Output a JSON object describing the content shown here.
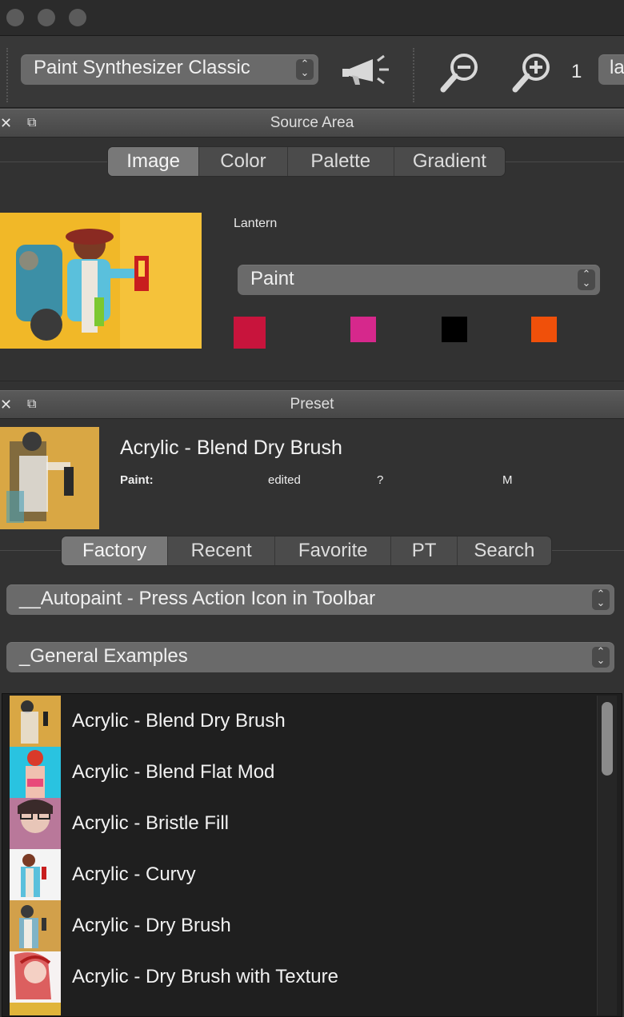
{
  "toolbar": {
    "preset_select": "Paint Synthesizer Classic",
    "zoom_value": "1",
    "truncated_select": "la"
  },
  "source_area": {
    "title": "Source Area",
    "tabs": [
      {
        "label": "Image",
        "active": true
      },
      {
        "label": "Color",
        "active": false
      },
      {
        "label": "Palette",
        "active": false
      },
      {
        "label": "Gradient",
        "active": false
      }
    ],
    "image_name": "Lantern",
    "paint_select": "Paint",
    "swatches": [
      "#c8143c",
      "#d6288c",
      "#000000",
      "#f0500a"
    ]
  },
  "preset": {
    "title": "Preset",
    "name": "Acrylic - Blend Dry Brush",
    "meta": {
      "label": "Paint:",
      "status": "edited",
      "question": "?",
      "size": "M"
    },
    "tabs": [
      {
        "label": "Factory",
        "active": true
      },
      {
        "label": "Recent",
        "active": false
      },
      {
        "label": "Favorite",
        "active": false
      },
      {
        "label": "PT",
        "active": false
      },
      {
        "label": "Search",
        "active": false
      }
    ],
    "category_select": "__Autopaint - Press Action Icon in Toolbar",
    "subcategory_select": "_General Examples",
    "items": [
      {
        "label": "Acrylic - Blend Dry Brush",
        "bg": "#d9a744"
      },
      {
        "label": "Acrylic - Blend Flat Mod",
        "bg": "#29c3e0"
      },
      {
        "label": "Acrylic - Bristle Fill",
        "bg": "#b9789a"
      },
      {
        "label": "Acrylic - Curvy",
        "bg": "#f4f4f4"
      },
      {
        "label": "Acrylic - Dry Brush",
        "bg": "#d2a04a"
      },
      {
        "label": "Acrylic - Dry Brush with Texture",
        "bg": "#f6f2f2"
      }
    ]
  }
}
